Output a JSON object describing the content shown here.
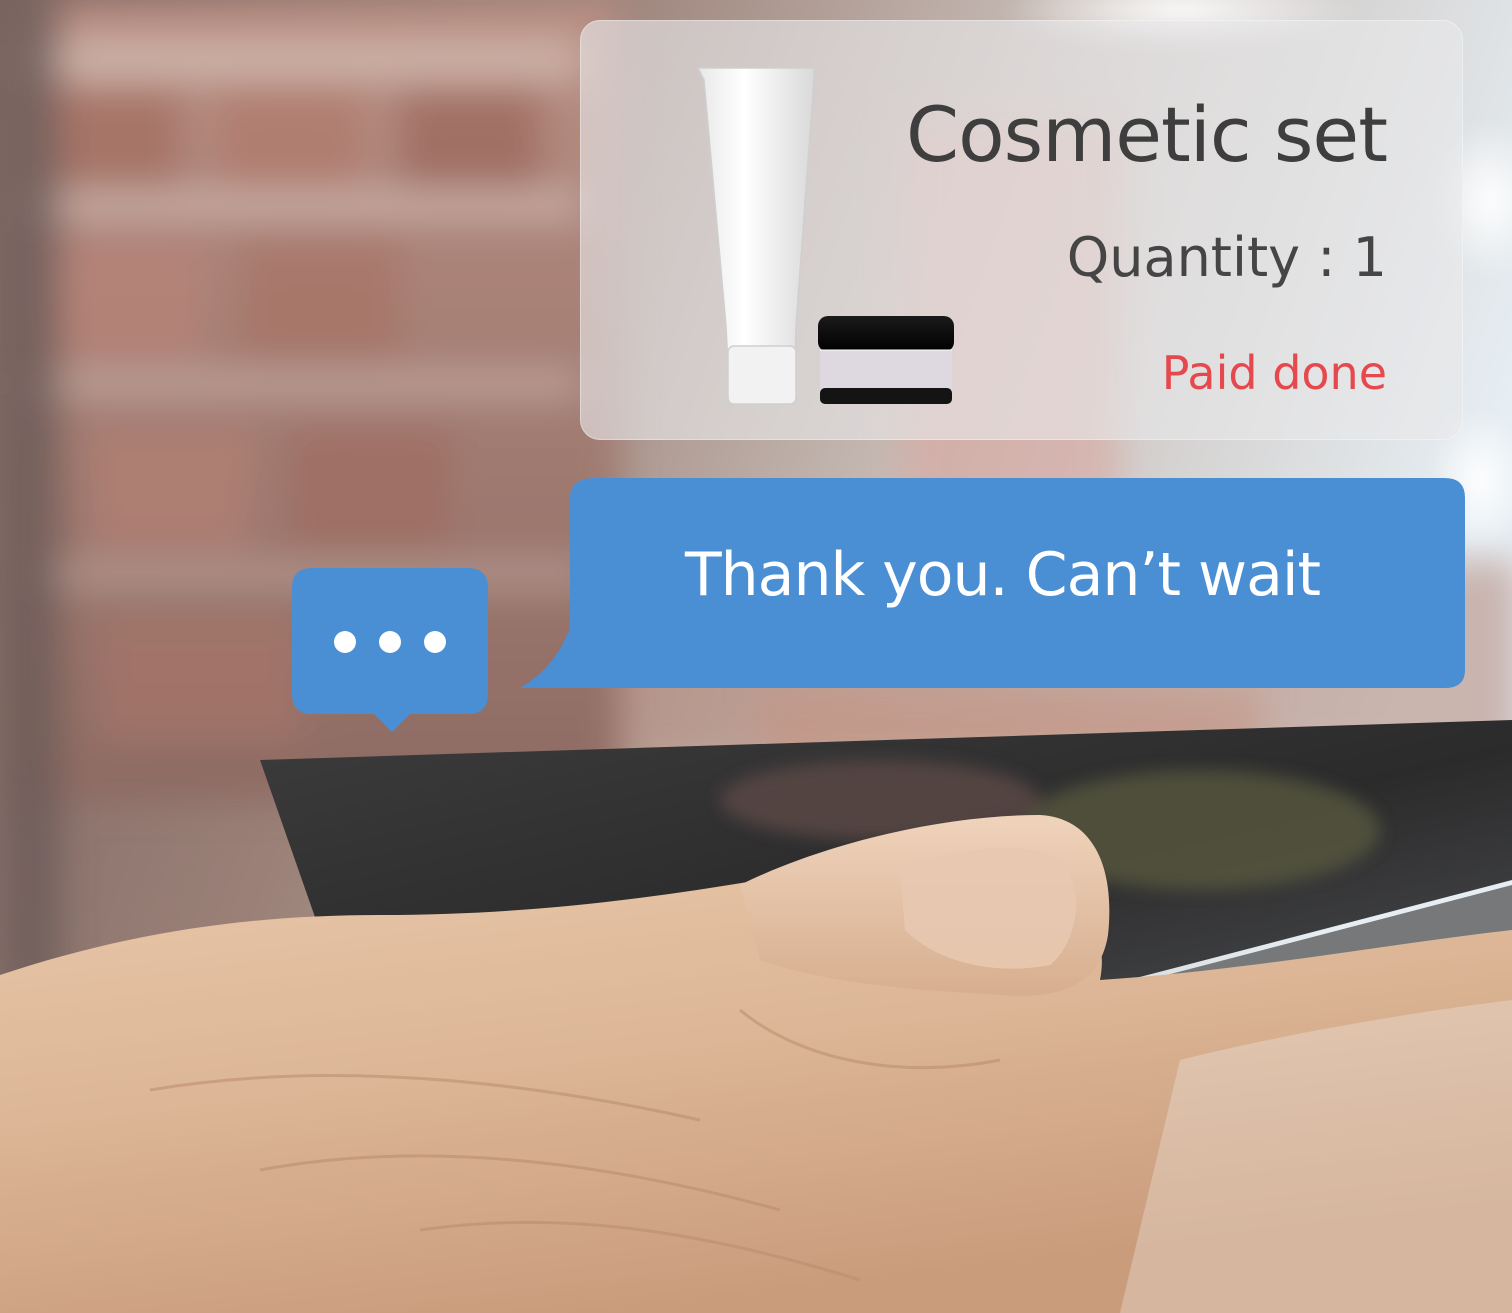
{
  "product_card": {
    "title": "Cosmetic set",
    "quantity_text": "Quantity : 1",
    "status": "Paid done",
    "status_color": "#e5484d"
  },
  "message": {
    "text": "Thank you. Can’t wait",
    "bubble_color": "#4a8fd4"
  },
  "typing_indicator": {
    "icon": "typing-dots-icon",
    "bubble_color": "#4a8fd4"
  }
}
